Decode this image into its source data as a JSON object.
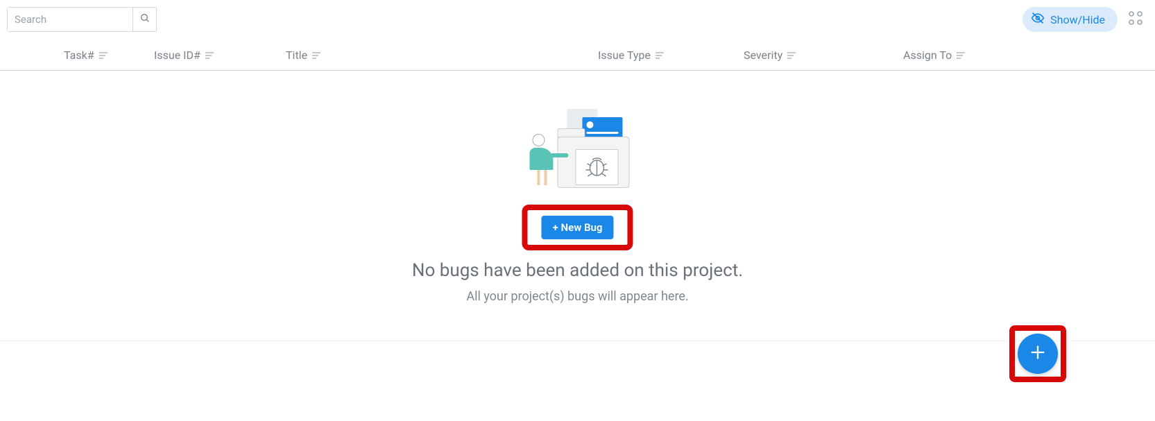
{
  "search": {
    "placeholder": "Search"
  },
  "top_right": {
    "show_hide_label": "Show/Hide"
  },
  "columns": {
    "task": "Task#",
    "issue_id": "Issue ID#",
    "title": "Title",
    "issue_type": "Issue Type",
    "severity": "Severity",
    "assign_to": "Assign To"
  },
  "empty": {
    "new_bug_label": "+ New Bug",
    "title": "No bugs have been added on this project.",
    "subtitle": "All your project(s) bugs will appear here."
  }
}
